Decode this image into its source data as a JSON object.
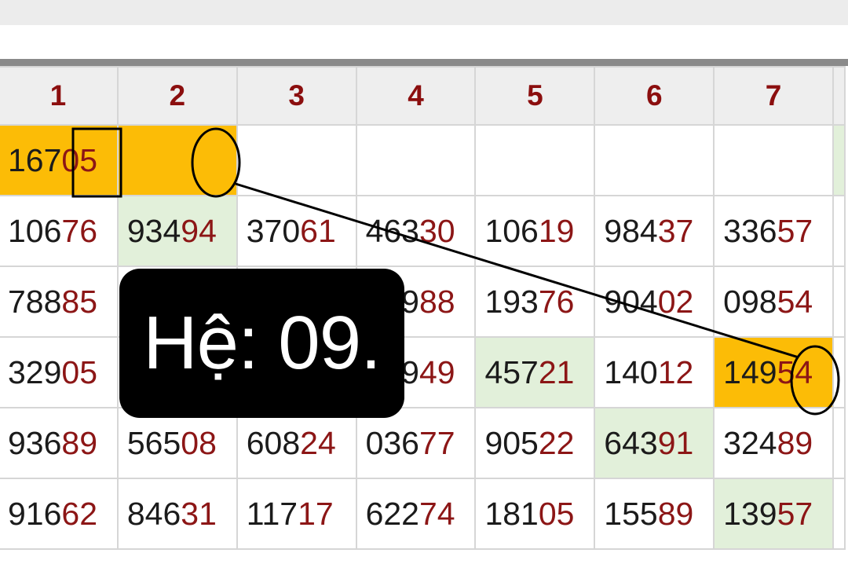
{
  "columns": [
    "1",
    "2",
    "3",
    "4",
    "5",
    "6",
    "7"
  ],
  "rows": [
    [
      {
        "head": "167",
        "tail": "05",
        "hl": "gold"
      },
      {
        "head": "",
        "tail": "",
        "hl": "gold"
      },
      {
        "head": "",
        "tail": "",
        "hl": "none"
      },
      {
        "head": "",
        "tail": "",
        "hl": "none"
      },
      {
        "head": "",
        "tail": "",
        "hl": "none"
      },
      {
        "head": "",
        "tail": "",
        "hl": "none"
      },
      {
        "head": "",
        "tail": "",
        "hl": "none"
      }
    ],
    [
      {
        "head": "106",
        "tail": "76",
        "hl": "none"
      },
      {
        "head": "934",
        "tail": "94",
        "hl": "green"
      },
      {
        "head": "370",
        "tail": "61",
        "hl": "none"
      },
      {
        "head": "463",
        "tail": "30",
        "hl": "none"
      },
      {
        "head": "106",
        "tail": "19",
        "hl": "none"
      },
      {
        "head": "984",
        "tail": "37",
        "hl": "none"
      },
      {
        "head": "336",
        "tail": "57",
        "hl": "none"
      }
    ],
    [
      {
        "head": "788",
        "tail": "85",
        "hl": "none"
      },
      {
        "head": "",
        "tail": "",
        "hl": "none"
      },
      {
        "head": "",
        "tail": "",
        "hl": "none"
      },
      {
        "head": "129",
        "tail": "88",
        "hl": "none"
      },
      {
        "head": "193",
        "tail": "76",
        "hl": "none"
      },
      {
        "head": "904",
        "tail": "02",
        "hl": "none"
      },
      {
        "head": "098",
        "tail": "54",
        "hl": "none"
      }
    ],
    [
      {
        "head": "329",
        "tail": "05",
        "hl": "none"
      },
      {
        "head": "",
        "tail": "",
        "hl": "none"
      },
      {
        "head": "",
        "tail": "",
        "hl": "none"
      },
      {
        "head": "149",
        "tail": "49",
        "hl": "none"
      },
      {
        "head": "457",
        "tail": "21",
        "hl": "green"
      },
      {
        "head": "140",
        "tail": "12",
        "hl": "none"
      },
      {
        "head": "149",
        "tail": "54",
        "hl": "gold"
      }
    ],
    [
      {
        "head": "936",
        "tail": "89",
        "hl": "none"
      },
      {
        "head": "565",
        "tail": "08",
        "hl": "none"
      },
      {
        "head": "608",
        "tail": "24",
        "hl": "none"
      },
      {
        "head": "036",
        "tail": "77",
        "hl": "none"
      },
      {
        "head": "905",
        "tail": "22",
        "hl": "none"
      },
      {
        "head": "643",
        "tail": "91",
        "hl": "green"
      },
      {
        "head": "324",
        "tail": "89",
        "hl": "none"
      }
    ],
    [
      {
        "head": "916",
        "tail": "62",
        "hl": "none"
      },
      {
        "head": "846",
        "tail": "31",
        "hl": "none"
      },
      {
        "head": "117",
        "tail": "17",
        "hl": "none"
      },
      {
        "head": "622",
        "tail": "74",
        "hl": "none"
      },
      {
        "head": "181",
        "tail": "05",
        "hl": "none"
      },
      {
        "head": "155",
        "tail": "89",
        "hl": "none"
      },
      {
        "head": "139",
        "tail": "57",
        "hl": "green"
      }
    ]
  ],
  "edge_highlight": [
    "green",
    "none",
    "none",
    "none",
    "none",
    "none"
  ],
  "badge": {
    "text": "Hệ: 09."
  },
  "colors": {
    "gold": "#fcbc06",
    "green": "#e2f0da",
    "digit_highlight": "#8c1616",
    "header_text": "#8b0e0e"
  }
}
